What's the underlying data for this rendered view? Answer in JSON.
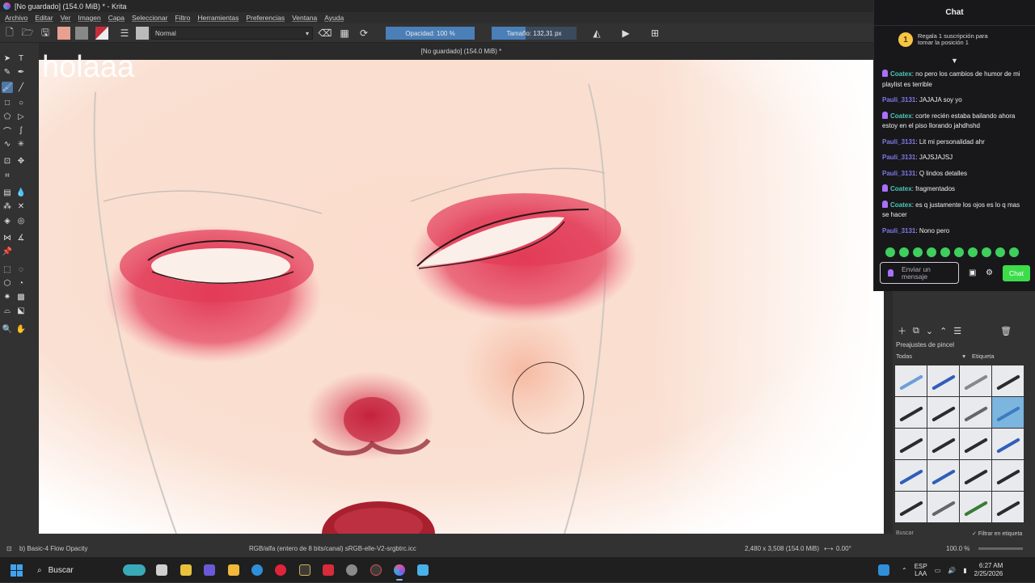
{
  "window": {
    "title": "[No guardado]  (154.0 MiB) * - Krita"
  },
  "menu": [
    "Archivo",
    "Editar",
    "Ver",
    "Imagen",
    "Capa",
    "Seleccionar",
    "Filtro",
    "Herramientas",
    "Preferencias",
    "Ventana",
    "Ayuda"
  ],
  "toolbar": {
    "blend_mode": "Normal",
    "opacity_label": "Opacidad: 100 %",
    "opacity_value": 1.0,
    "size_label": "Tamaño:",
    "size_value": "132,31 px"
  },
  "document": {
    "tab_title": "[No guardado]  (154.0 MiB) *",
    "overlay_text": "holaaa"
  },
  "chat": {
    "title": "Chat",
    "gift_rank": "1",
    "gift_text": "Regala 1 suscripción para tomar la posición 1",
    "messages": [
      {
        "user": "Coatex",
        "badge": true,
        "text": ": no pero los cambios de humor de mi playlist es terrible"
      },
      {
        "user": "Pauli_3131",
        "badge": false,
        "text": ": JAJAJA soy yo"
      },
      {
        "user": "Coatex",
        "badge": true,
        "text": ": corte recién estaba bailando ahora estoy en el piso llorando jahdhshd"
      },
      {
        "user": "Pauli_3131",
        "badge": false,
        "text": ": Lit mi personalidad ahr"
      },
      {
        "user": "Pauli_3131",
        "badge": false,
        "text": ": JAJSJAJSJ"
      },
      {
        "user": "Pauli_3131",
        "badge": false,
        "text": ": Q lindos detalles"
      },
      {
        "user": "Coatex",
        "badge": true,
        "text": ": fragmentados"
      },
      {
        "user": "Coatex",
        "badge": true,
        "text": ": es q justamente los ojos es lo q mas se hacer"
      },
      {
        "user": "Pauli_3131",
        "badge": false,
        "text": ": Nono pero"
      }
    ],
    "input_placeholder": "Enviar un mensaje",
    "send_label": "Chat"
  },
  "brush_presets": {
    "title": "Preajustes de pincel",
    "filter": "Todas",
    "tag_label": "Etiqueta",
    "search_placeholder": "Buscar",
    "filter_tag_label": "Filtrar en etiqueta"
  },
  "status": {
    "brush": "b) Basic-4 Flow Opacity",
    "color_space": "RGB/alfa (entero de 8 bits/canal)  sRGB-elle-V2-srgbtrc.icc",
    "image_size": "2,480 x 3,508 (154.0 MiB)",
    "rotation": "0.00°",
    "zoom": "100.0 %"
  },
  "taskbar": {
    "search_label": "Buscar",
    "lang_top": "ESP",
    "lang_bottom": "LAA",
    "time": "6:27 AM",
    "date": "2/25/2026"
  },
  "colors": {
    "accent": "#4a7fb8",
    "chat_send": "#3ddc4b",
    "user_coatex": "#4ec9b7",
    "user_pauli": "#7c79e8"
  }
}
